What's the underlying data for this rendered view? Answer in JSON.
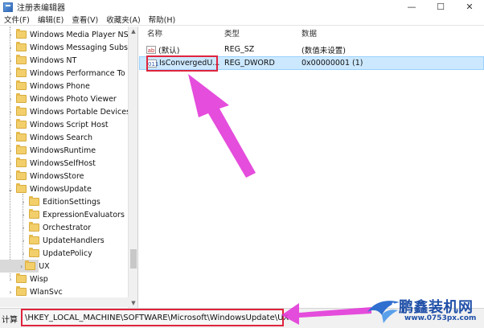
{
  "window": {
    "title": "注册表编辑器",
    "controls": {
      "minimize": "—",
      "maximize": "☐",
      "close": "✕"
    }
  },
  "menu": [
    "文件(F)",
    "编辑(E)",
    "查看(V)",
    "收藏夹(A)",
    "帮助(H)"
  ],
  "tree": {
    "items": [
      {
        "label": "Windows Media Player NS",
        "arrow": "›"
      },
      {
        "label": "Windows Messaging Subs",
        "arrow": "›"
      },
      {
        "label": "Windows NT",
        "arrow": "›"
      },
      {
        "label": "Windows Performance To",
        "arrow": "›"
      },
      {
        "label": "Windows Phone",
        "arrow": "›"
      },
      {
        "label": "Windows Photo Viewer",
        "arrow": "›"
      },
      {
        "label": "Windows Portable Devices",
        "arrow": "›"
      },
      {
        "label": "Windows Script Host",
        "arrow": "›"
      },
      {
        "label": "Windows Search",
        "arrow": "›"
      },
      {
        "label": "WindowsRuntime",
        "arrow": "›"
      },
      {
        "label": "WindowsSelfHost",
        "arrow": "›"
      },
      {
        "label": "WindowsStore",
        "arrow": "›"
      },
      {
        "label": "WindowsUpdate",
        "arrow": "⌄"
      },
      {
        "label": "EditionSettings",
        "arrow": "›"
      },
      {
        "label": "ExpressionEvaluators",
        "arrow": "›"
      },
      {
        "label": "Orchestrator",
        "arrow": "›"
      },
      {
        "label": "UpdateHandlers",
        "arrow": "›"
      },
      {
        "label": "UpdatePolicy",
        "arrow": "›"
      },
      {
        "label": "UX",
        "arrow": "›"
      },
      {
        "label": "Wisp",
        "arrow": "›"
      },
      {
        "label": "WlanSvc",
        "arrow": "›"
      }
    ]
  },
  "list": {
    "headers": {
      "name": "名称",
      "type": "类型",
      "data": "数据"
    },
    "rows": [
      {
        "icon": "ab",
        "name": "(默认)",
        "type": "REG_SZ",
        "data": "(数值未设置)"
      },
      {
        "icon": "011",
        "name": "IsConvergedU...",
        "type": "REG_DWORD",
        "data": "0x00000001 (1)"
      }
    ]
  },
  "status": {
    "label": "计算",
    "path": "\\HKEY_LOCAL_MACHINE\\SOFTWARE\\Microsoft\\WindowsUpdate\\UX"
  },
  "watermark": {
    "brand": "鹏鑫装机网",
    "url": "www.0753px.com"
  },
  "colors": {
    "highlight": "#e0243d",
    "arrow": "#e23ad8",
    "selection": "#cce8ff"
  }
}
